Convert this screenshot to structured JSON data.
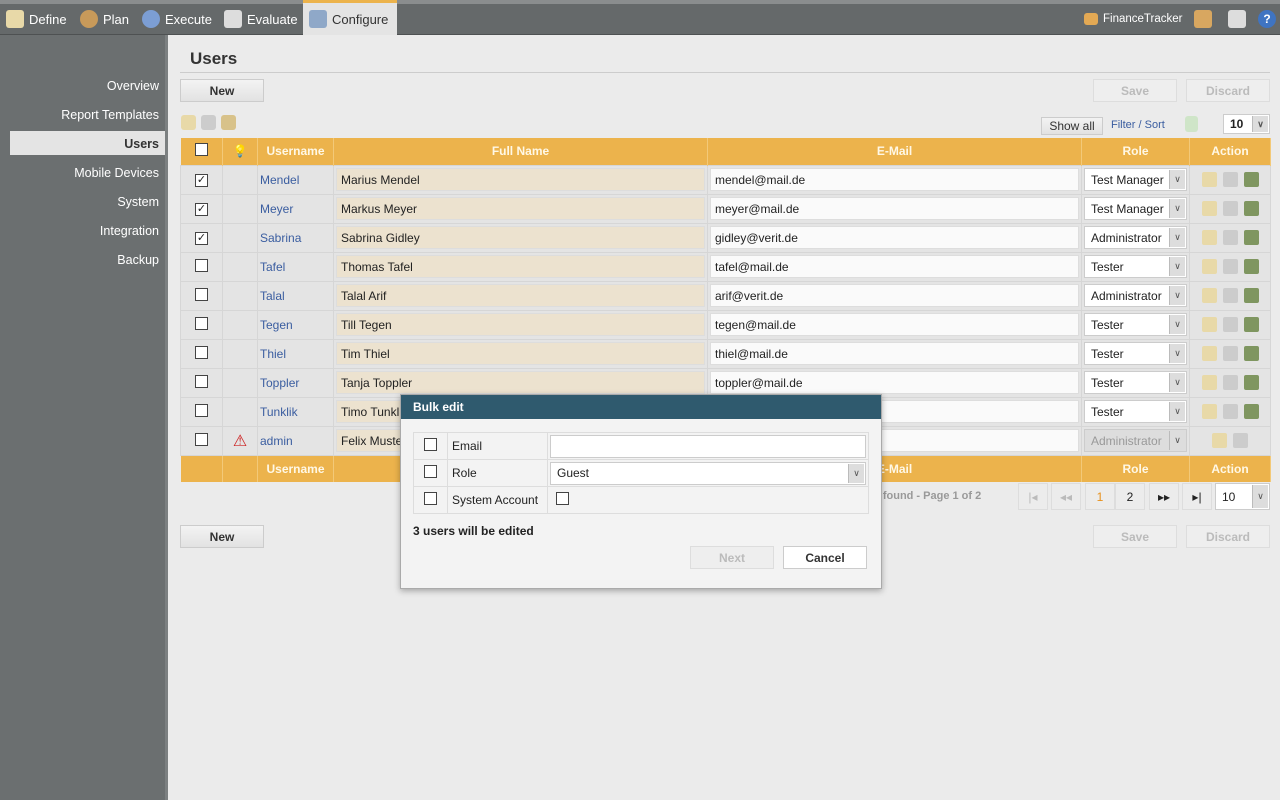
{
  "topnav": {
    "tabs": [
      "Define",
      "Plan",
      "Execute",
      "Evaluate",
      "Configure"
    ],
    "active": "Configure",
    "project": "FinanceTracker"
  },
  "sidebar": {
    "items": [
      "Overview",
      "Report Templates",
      "Users",
      "Mobile Devices",
      "System",
      "Integration",
      "Backup"
    ],
    "active": "Users"
  },
  "page": {
    "title": "Users",
    "new": "New",
    "save": "Save",
    "discard": "Discard",
    "show_all": "Show all",
    "filter_sort": "Filter / Sort",
    "page_size": "10"
  },
  "table": {
    "headers": [
      "Username",
      "Full Name",
      "E-Mail",
      "Role",
      "Action"
    ],
    "rows": [
      {
        "username": "Mendel",
        "full_name": "Marius Mendel",
        "email": "mendel@mail.de",
        "role": "Test Manager",
        "checked": true
      },
      {
        "username": "Meyer",
        "full_name": "Markus Meyer",
        "email": "meyer@mail.de",
        "role": "Test Manager",
        "checked": true
      },
      {
        "username": "Sabrina",
        "full_name": "Sabrina Gidley",
        "email": "gidley@verit.de",
        "role": "Administrator",
        "checked": true
      },
      {
        "username": "Tafel",
        "full_name": "Thomas Tafel",
        "email": "tafel@mail.de",
        "role": "Tester",
        "checked": false
      },
      {
        "username": "Talal",
        "full_name": "Talal Arif",
        "email": "arif@verit.de",
        "role": "Administrator",
        "checked": false
      },
      {
        "username": "Tegen",
        "full_name": "Till Tegen",
        "email": "tegen@mail.de",
        "role": "Tester",
        "checked": false
      },
      {
        "username": "Thiel",
        "full_name": "Tim Thiel",
        "email": "thiel@mail.de",
        "role": "Tester",
        "checked": false
      },
      {
        "username": "Toppler",
        "full_name": "Tanja Toppler",
        "email": "toppler@mail.de",
        "role": "Tester",
        "checked": false
      },
      {
        "username": "Tunklik",
        "full_name": "Timo Tunklik",
        "email": "",
        "role": "Tester",
        "checked": false
      },
      {
        "username": "admin",
        "full_name": "Felix Muster",
        "email": "",
        "role": "Administrator",
        "checked": false,
        "warning": true,
        "disabled": true
      }
    ]
  },
  "pagination": {
    "status": "ts found - Page 1 of 2",
    "pages": [
      "1",
      "2"
    ],
    "current": "1",
    "page_size": "10"
  },
  "modal": {
    "title": "Bulk edit",
    "fields": [
      "Email",
      "Role",
      "System Account"
    ],
    "role_value": "Guest",
    "email_value": "",
    "info": "3 users will be edited",
    "next": "Next",
    "cancel": "Cancel"
  }
}
